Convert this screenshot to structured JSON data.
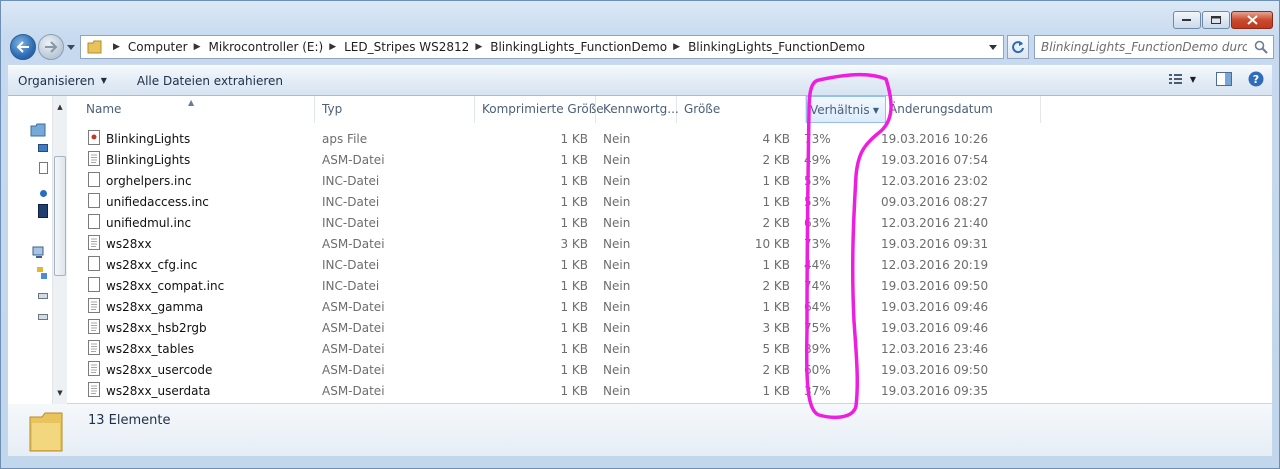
{
  "window": {
    "caption_buttons": [
      "minimize-icon",
      "maximize-icon",
      "close-icon"
    ]
  },
  "navigation": {
    "breadcrumbs": [
      "Computer",
      "Mikrocontroller (E:)",
      "LED_Stripes WS2812",
      "BlinkingLights_FunctionDemo",
      "BlinkingLights_FunctionDemo"
    ],
    "search_placeholder": "BlinkingLights_FunctionDemo durchs..."
  },
  "toolbar": {
    "organize_label": "Organisieren",
    "extract_label": "Alle Dateien extrahieren"
  },
  "columns": {
    "name": "Name",
    "typ": "Typ",
    "komprimiert": "Komprimierte Größe",
    "kennwort": "Kennwortg...",
    "groesse": "Größe",
    "verhaeltnis": "Verhältnis",
    "datum": "Änderungsdatum"
  },
  "files": [
    {
      "name": "BlinkingLights",
      "typ": "aps File",
      "komp": "1 KB",
      "kenn": "Nein",
      "groesse": "4 KB",
      "verh": "73%",
      "datum": "19.03.2016 10:26",
      "icon": "aps-file-icon"
    },
    {
      "name": "BlinkingLights",
      "typ": "ASM-Datei",
      "komp": "1 KB",
      "kenn": "Nein",
      "groesse": "2 KB",
      "verh": "49%",
      "datum": "19.03.2016 07:54",
      "icon": "text-file-icon"
    },
    {
      "name": "orghelpers.inc",
      "typ": "INC-Datei",
      "komp": "1 KB",
      "kenn": "Nein",
      "groesse": "1 KB",
      "verh": "53%",
      "datum": "12.03.2016 23:02",
      "icon": "blank-file-icon"
    },
    {
      "name": "unifiedaccess.inc",
      "typ": "INC-Datei",
      "komp": "1 KB",
      "kenn": "Nein",
      "groesse": "1 KB",
      "verh": "53%",
      "datum": "09.03.2016 08:27",
      "icon": "blank-file-icon"
    },
    {
      "name": "unifiedmul.inc",
      "typ": "INC-Datei",
      "komp": "1 KB",
      "kenn": "Nein",
      "groesse": "2 KB",
      "verh": "63%",
      "datum": "12.03.2016 21:40",
      "icon": "blank-file-icon"
    },
    {
      "name": "ws28xx",
      "typ": "ASM-Datei",
      "komp": "3 KB",
      "kenn": "Nein",
      "groesse": "10 KB",
      "verh": "73%",
      "datum": "19.03.2016 09:31",
      "icon": "text-file-icon"
    },
    {
      "name": "ws28xx_cfg.inc",
      "typ": "INC-Datei",
      "komp": "1 KB",
      "kenn": "Nein",
      "groesse": "1 KB",
      "verh": "44%",
      "datum": "12.03.2016 20:19",
      "icon": "blank-file-icon"
    },
    {
      "name": "ws28xx_compat.inc",
      "typ": "INC-Datei",
      "komp": "1 KB",
      "kenn": "Nein",
      "groesse": "2 KB",
      "verh": "74%",
      "datum": "19.03.2016 09:50",
      "icon": "blank-file-icon"
    },
    {
      "name": "ws28xx_gamma",
      "typ": "ASM-Datei",
      "komp": "1 KB",
      "kenn": "Nein",
      "groesse": "1 KB",
      "verh": "64%",
      "datum": "19.03.2016 09:46",
      "icon": "text-file-icon"
    },
    {
      "name": "ws28xx_hsb2rgb",
      "typ": "ASM-Datei",
      "komp": "1 KB",
      "kenn": "Nein",
      "groesse": "3 KB",
      "verh": "75%",
      "datum": "19.03.2016 09:46",
      "icon": "text-file-icon"
    },
    {
      "name": "ws28xx_tables",
      "typ": "ASM-Datei",
      "komp": "1 KB",
      "kenn": "Nein",
      "groesse": "5 KB",
      "verh": "89%",
      "datum": "12.03.2016 23:46",
      "icon": "text-file-icon"
    },
    {
      "name": "ws28xx_usercode",
      "typ": "ASM-Datei",
      "komp": "1 KB",
      "kenn": "Nein",
      "groesse": "2 KB",
      "verh": "60%",
      "datum": "19.03.2016 09:50",
      "icon": "text-file-icon"
    },
    {
      "name": "ws28xx_userdata",
      "typ": "ASM-Datei",
      "komp": "1 KB",
      "kenn": "Nein",
      "groesse": "1 KB",
      "verh": "37%",
      "datum": "19.03.2016 09:35",
      "icon": "text-file-icon"
    }
  ],
  "status": {
    "item_count": "13 Elemente"
  },
  "colors": {
    "annotation": "#ee1ee0",
    "sorted_header": "#dcebfb"
  }
}
